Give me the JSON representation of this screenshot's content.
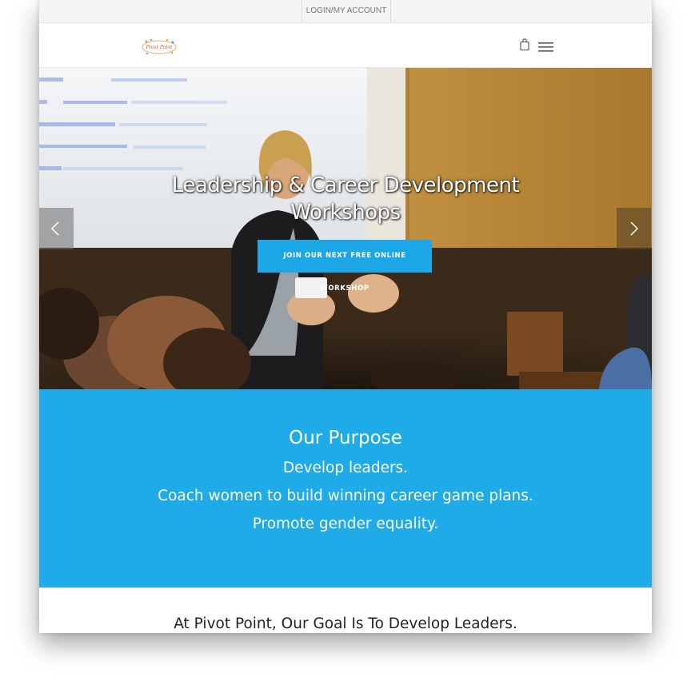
{
  "topbar": {
    "login_label": "LOGIN/MY ACCOUNT"
  },
  "header": {
    "logo_text": "Pivot Point",
    "cart_icon": "shopping-bag-icon",
    "menu_icon": "hamburger-menu-icon"
  },
  "hero": {
    "title_line1": "Leadership & Career Development",
    "title_line2": "Workshops",
    "cta_label": "JOIN OUR NEXT FREE ONLINE WORKSHOP",
    "prev_icon": "chevron-left-icon",
    "next_icon": "chevron-right-icon"
  },
  "purpose": {
    "title": "Our Purpose",
    "lines": [
      "Develop leaders.",
      "Coach women to build winning career game plans.",
      "Promote gender equality."
    ]
  },
  "goal": {
    "heading": "At Pivot Point, Our Goal Is To Develop Leaders."
  },
  "colors": {
    "accent": "#1faae8",
    "button": "#1ea7e7",
    "topbar": "#f4f4f4"
  }
}
